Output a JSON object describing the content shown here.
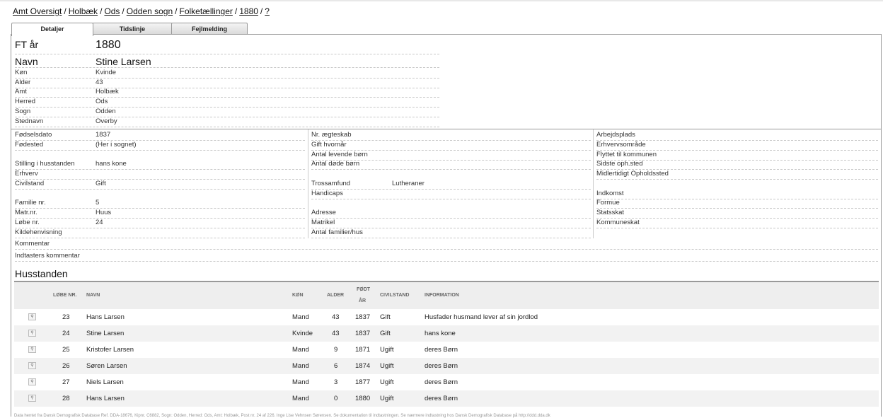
{
  "breadcrumb": {
    "items": [
      "Amt Oversigt",
      "Holbæk",
      "Ods",
      "Odden sogn",
      "Folketællinger",
      "1880",
      "?"
    ]
  },
  "tabs": [
    "Detaljer",
    "Tidslinje",
    "Fejlmelding"
  ],
  "header": {
    "ft_label": "FT år",
    "ft_value": "1880",
    "name_label": "Navn",
    "name_value": "Stine Larsen"
  },
  "top_fields": [
    {
      "label": "Køn",
      "value": "Kvinde"
    },
    {
      "label": "Alder",
      "value": "43"
    },
    {
      "label": "Amt",
      "value": "Holbæk"
    },
    {
      "label": "Herred",
      "value": "Ods"
    },
    {
      "label": "Sogn",
      "value": "Odden"
    },
    {
      "label": "Stednavn",
      "value": "Overby"
    }
  ],
  "col1": {
    "r1": {
      "label": "Fødselsdato",
      "value": "1837"
    },
    "r2": {
      "label": "Fødested",
      "value": "(Her i sognet)"
    },
    "r3": {
      "label": "Stilling i husstanden",
      "value": "hans kone"
    },
    "r4": {
      "label": "Erhverv",
      "value": ""
    },
    "r5": {
      "label": "Civilstand",
      "value": "Gift"
    },
    "r6": {
      "label": "Familie nr.",
      "value": "5"
    },
    "r7": {
      "label": "Matr.nr.",
      "value": "Huus"
    },
    "r8": {
      "label": "Løbe nr.",
      "value": "24"
    },
    "r9": {
      "label": "Kildehenvisning",
      "value": ""
    }
  },
  "col2": {
    "r1": {
      "label": "Nr. ægteskab",
      "value": ""
    },
    "r2": {
      "label": "Gift hvornår",
      "value": ""
    },
    "r3": {
      "label": "Antal levende børn",
      "value": ""
    },
    "r4": {
      "label": "Antal døde børn",
      "value": ""
    },
    "r5": {
      "label": "Trossamfund",
      "value": "Lutheraner"
    },
    "r6": {
      "label": "Handicaps",
      "value": ""
    },
    "r7": {
      "label": "Adresse",
      "value": ""
    },
    "r8": {
      "label": "Matrikel",
      "value": ""
    },
    "r9": {
      "label": "Antal familier/hus",
      "value": ""
    }
  },
  "col3": {
    "r1": {
      "label": "Arbejdsplads"
    },
    "r2": {
      "label": "Erhvervsområde"
    },
    "r3": {
      "label": "Flyttet til kommunen"
    },
    "r4": {
      "label": "Sidste oph.sted"
    },
    "r5": {
      "label": "Midlertidigt Opholdssted"
    },
    "r6": {
      "label": "Indkomst"
    },
    "r7": {
      "label": "Formue"
    },
    "r8": {
      "label": "Statsskat"
    },
    "r9": {
      "label": "Kommuneskat"
    }
  },
  "comments": {
    "kommentar": "Kommentar",
    "indtaster": "Indtasters kommentar"
  },
  "household": {
    "title": "Husstanden",
    "headers": {
      "lobe": "LØBE NR.",
      "navn": "NAVN",
      "kon": "KØN",
      "alder": "ALDER",
      "fodt1": "FØDT",
      "fodt2": "ÅR",
      "civil": "CIVILSTAND",
      "info": "INFORMATION"
    },
    "rows": [
      {
        "lobe": "23",
        "navn": "Hans Larsen",
        "kon": "Mand",
        "alder": "43",
        "fodt": "1837",
        "civil": "Gift",
        "info": "Husfader husmand lever af sin jordlod"
      },
      {
        "lobe": "24",
        "navn": "Stine Larsen",
        "kon": "Kvinde",
        "alder": "43",
        "fodt": "1837",
        "civil": "Gift",
        "info": "hans kone"
      },
      {
        "lobe": "25",
        "navn": "Kristofer Larsen",
        "kon": "Mand",
        "alder": "9",
        "fodt": "1871",
        "civil": "Ugift",
        "info": "deres Børn"
      },
      {
        "lobe": "26",
        "navn": "Søren Larsen",
        "kon": "Mand",
        "alder": "6",
        "fodt": "1874",
        "civil": "Ugift",
        "info": "deres Børn"
      },
      {
        "lobe": "27",
        "navn": "Niels Larsen",
        "kon": "Mand",
        "alder": "3",
        "fodt": "1877",
        "civil": "Ugift",
        "info": "deres Børn"
      },
      {
        "lobe": "28",
        "navn": "Hans Larsen",
        "kon": "Mand",
        "alder": "0",
        "fodt": "1880",
        "civil": "Ugift",
        "info": "deres Børn"
      }
    ]
  },
  "footer": "Data hentet fra Dansk Demografisk Database Ref. DDA-18676, Kipnr. C6882, Sogn: Odden, Herred: Ods, Amt: Holbæk, Post nr. 24 af 226. Inge Lise Vehnsen Sørensen. Se dokumentation til indtastningen. Se nærmere indtastning hos Dansk Demografisk Database på http://ddd.dda.dk"
}
